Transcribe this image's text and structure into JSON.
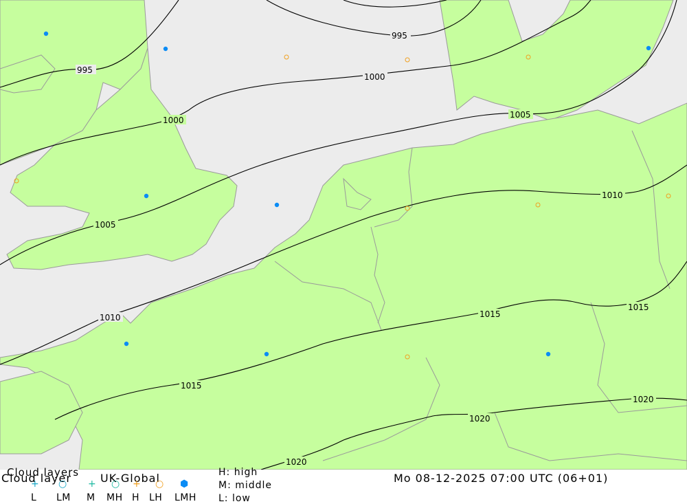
{
  "map": {
    "title_line1": "Cloud layers",
    "title_line2": "Cloud layer",
    "model": "UK-Global",
    "datetime": "Mo 08-12-2025 07:00 UTC (06+01)",
    "colors": {
      "sea": "#ececec",
      "land": "#c6fe9e",
      "border": "#9a9a9a",
      "isobar": "#000000",
      "marker_lmh": "#0b8cf5",
      "marker_h": "#f0a020",
      "marker_l": "#1aa8c8"
    },
    "isobars": [
      "995",
      "1000",
      "1005",
      "1010",
      "1015",
      "1020"
    ],
    "isobar_labels": [
      {
        "text": "995",
        "label_index": 0
      },
      {
        "text": "995",
        "label_index": 1
      },
      {
        "text": "1000",
        "label_index": 2
      },
      {
        "text": "1000",
        "label_index": 3
      },
      {
        "text": "1005",
        "label_index": 4
      },
      {
        "text": "1005",
        "label_index": 5
      },
      {
        "text": "1010",
        "label_index": 6
      },
      {
        "text": "1010",
        "label_index": 7
      },
      {
        "text": "1015",
        "label_index": 8
      },
      {
        "text": "1015",
        "label_index": 9
      },
      {
        "text": "1015",
        "label_index": 10
      },
      {
        "text": "1020",
        "label_index": 11
      },
      {
        "text": "1020",
        "label_index": 12
      },
      {
        "text": "1020",
        "label_index": 13
      }
    ]
  },
  "legend": {
    "symbols": [
      {
        "symbol": "+",
        "label": "L",
        "color": "#1aa8c8",
        "icon": "plus-icon"
      },
      {
        "symbol": "○",
        "label": "LM",
        "color": "#1aa8c8",
        "icon": "circle-icon"
      },
      {
        "symbol": "+",
        "label": "M",
        "color": "#1ab8a0",
        "icon": "plus-icon"
      },
      {
        "symbol": "○",
        "label": "MH",
        "color": "#1ab8a0",
        "icon": "circle-icon"
      },
      {
        "symbol": "+",
        "label": "H",
        "color": "#f0a020",
        "icon": "plus-icon"
      },
      {
        "symbol": "○",
        "label": "LH",
        "color": "#f0a020",
        "icon": "circle-icon"
      },
      {
        "symbol": "⬢",
        "label": "LMH",
        "color": "#0b8cf5",
        "icon": "filled-hexagon-icon"
      }
    ],
    "key_high": "H: high",
    "key_middle": "M: middle",
    "key_low": "L: low"
  }
}
